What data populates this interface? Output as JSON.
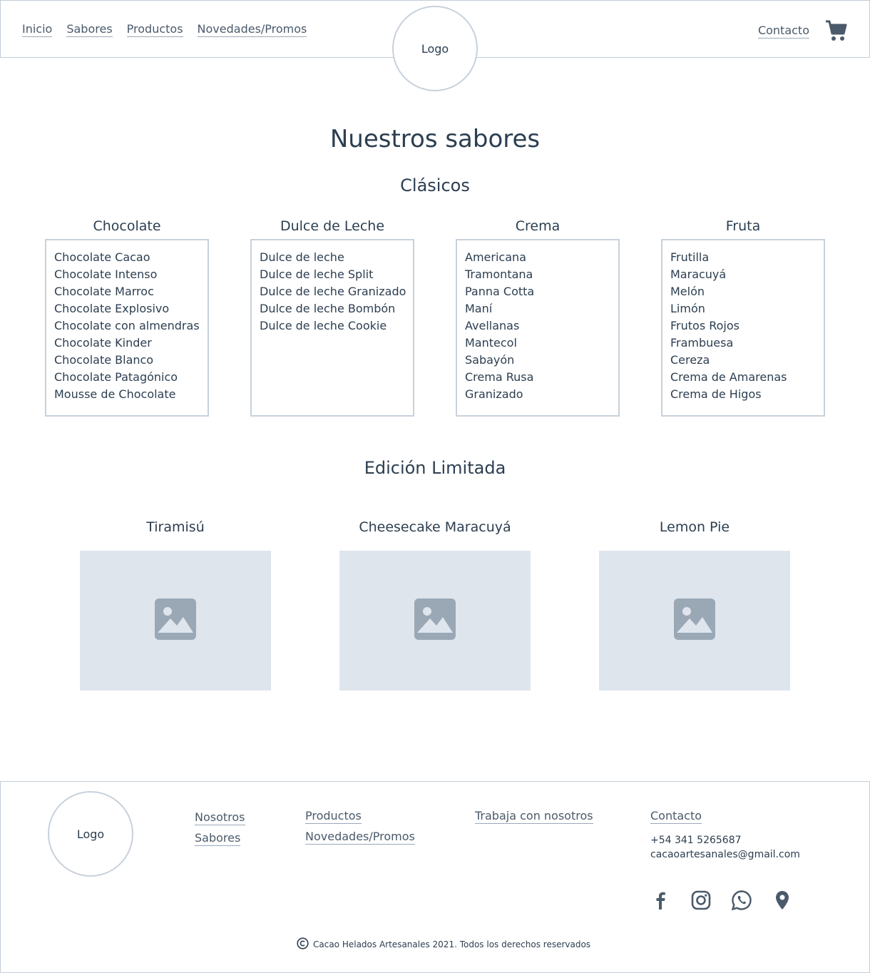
{
  "header": {
    "nav": [
      "Inicio",
      "Sabores",
      "Productos",
      "Novedades/Promos"
    ],
    "logo": "Logo",
    "contact": "Contacto",
    "cart_icon": "cart-icon"
  },
  "main": {
    "title": "Nuestros sabores",
    "classics_title": "Clásicos",
    "categories": [
      {
        "title": "Chocolate",
        "items": [
          "Chocolate Cacao",
          "Chocolate Intenso",
          "Chocolate Marroc",
          "Chocolate Explosivo",
          "Chocolate con almendras",
          "Chocolate Kinder",
          "Chocolate Blanco",
          "Chocolate Patagónico",
          "Mousse de Chocolate"
        ]
      },
      {
        "title": "Dulce de Leche",
        "items": [
          "Dulce de leche",
          "Dulce de leche Split",
          "Dulce de leche Granizado",
          "Dulce de leche Bombón",
          "Dulce de leche Cookie"
        ]
      },
      {
        "title": "Crema",
        "items": [
          "Americana",
          "Tramontana",
          "Panna Cotta",
          "Maní",
          "Avellanas",
          "Mantecol",
          "Sabayón",
          "Crema Rusa",
          "Granizado"
        ]
      },
      {
        "title": "Fruta",
        "items": [
          "Frutilla",
          "Maracuyá",
          "Melón",
          "Limón",
          "Frutos Rojos",
          "Frambuesa",
          "Cereza",
          "Crema de Amarenas",
          "Crema de Higos"
        ]
      }
    ],
    "limited_title": "Edición Limitada",
    "limited": [
      {
        "title": "Tiramisú",
        "icon": "image-placeholder-icon"
      },
      {
        "title": "Cheesecake Maracuyá",
        "icon": "image-placeholder-icon"
      },
      {
        "title": "Lemon Pie",
        "icon": "image-placeholder-icon"
      }
    ]
  },
  "footer": {
    "logo": "Logo",
    "col1": [
      "Nosotros",
      "Sabores"
    ],
    "col2": [
      "Productos",
      "Novedades/Promos"
    ],
    "col3": [
      "Trabaja con nosotros"
    ],
    "contact": "Contacto",
    "phone": "+54 341 5265687",
    "email": "cacaoartesanales@gmail.com",
    "socials": [
      "facebook-icon",
      "instagram-icon",
      "whatsapp-icon",
      "location-icon"
    ],
    "copyright": "Cacao Helados Artesanales 2021. Todos los derechos reservados"
  },
  "colors": {
    "text": "#2c3e50",
    "border": "#c8d1db",
    "placeholder_bg": "#dfe5ed",
    "icon": "#4a5a6a"
  }
}
